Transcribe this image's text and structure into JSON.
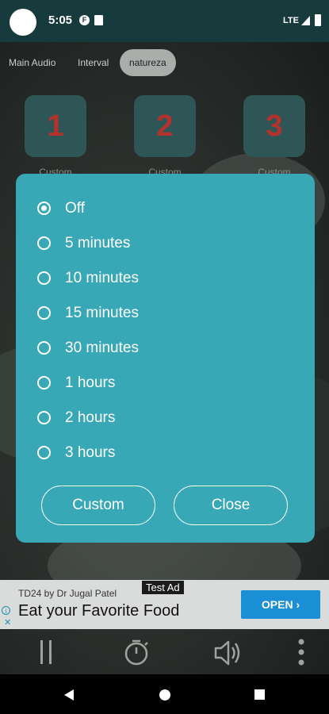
{
  "status_bar": {
    "time": "5:05",
    "network": "LTE"
  },
  "tabs": [
    {
      "label": "Main Audio"
    },
    {
      "label": "Interval"
    },
    {
      "label": "natureza"
    }
  ],
  "presets": [
    {
      "number": "1",
      "label": "Custom"
    },
    {
      "number": "2",
      "label": "Custom"
    },
    {
      "number": "3",
      "label": "Custom"
    }
  ],
  "timer_dialog": {
    "options": [
      {
        "label": "Off",
        "selected": true
      },
      {
        "label": "5 minutes",
        "selected": false
      },
      {
        "label": "10 minutes",
        "selected": false
      },
      {
        "label": "15 minutes",
        "selected": false
      },
      {
        "label": "30 minutes",
        "selected": false
      },
      {
        "label": "1 hours",
        "selected": false
      },
      {
        "label": "2 hours",
        "selected": false
      },
      {
        "label": "3 hours",
        "selected": false
      }
    ],
    "custom_label": "Custom",
    "close_label": "Close"
  },
  "ad": {
    "tag": "Test Ad",
    "advertiser": "TD24 by Dr Jugal Patel",
    "headline": "Eat your Favorite Food",
    "cta": "OPEN"
  },
  "controls": {
    "icons": [
      "pause-icon",
      "timer-icon",
      "volume-icon",
      "more-vert-icon"
    ]
  },
  "colors": {
    "dialog_bg": "#38a8b7",
    "status_bar": "#173b3c",
    "preset_number": "#b5322c",
    "ad_button": "#1a8fd6"
  }
}
